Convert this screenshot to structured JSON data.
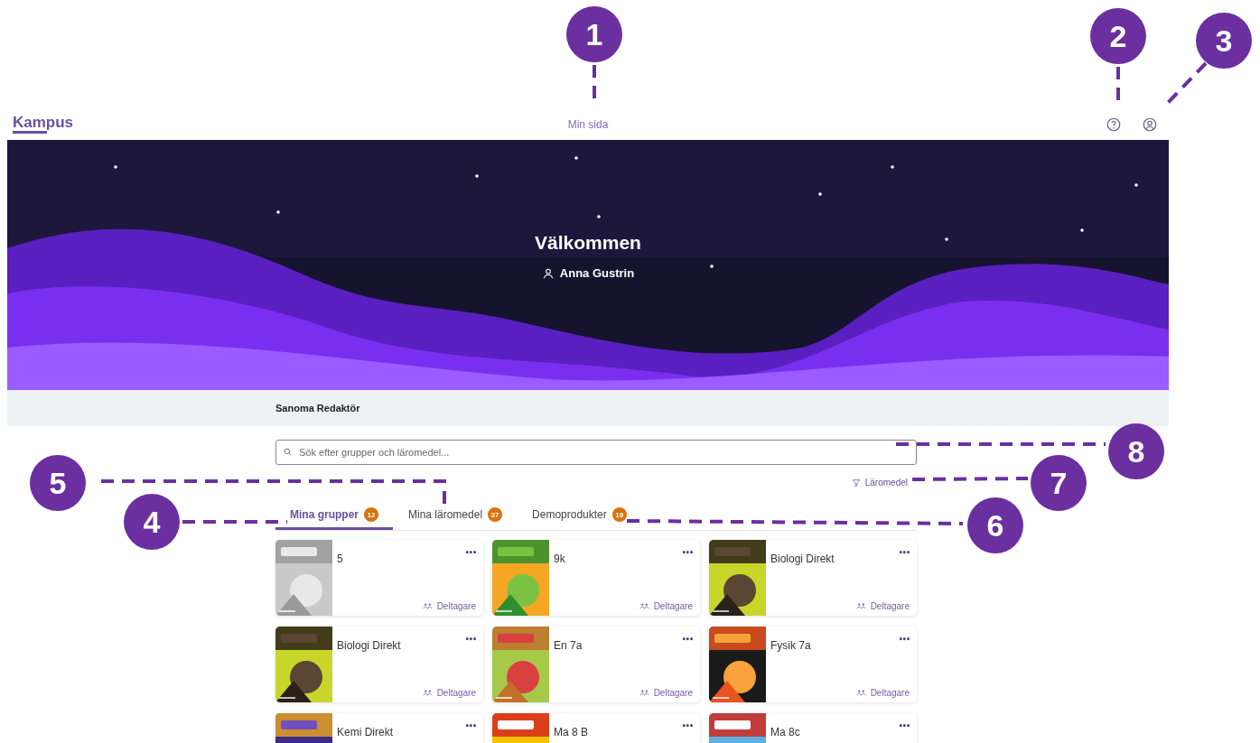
{
  "header": {
    "logo": "Kampus",
    "nav_link": "Min sida"
  },
  "banner": {
    "title": "Välkommen",
    "user": "Anna Gustrin"
  },
  "organization": "Sanoma Redaktör",
  "search": {
    "placeholder": "Sök efter grupper och läromedel..."
  },
  "filter": {
    "label": "Läromedel"
  },
  "tabs": [
    {
      "label": "Mina grupper",
      "count": "12",
      "selected": true
    },
    {
      "label": "Mina läromedel",
      "count": "37",
      "selected": false
    },
    {
      "label": "Demoprodukter",
      "count": "19",
      "selected": false
    }
  ],
  "cards": [
    {
      "title": "5",
      "menu": "•••",
      "participants": "Deltagare"
    },
    {
      "title": "9k",
      "menu": "•••",
      "participants": "Deltagare"
    },
    {
      "title": "Biologi Direkt",
      "menu": "•••",
      "participants": "Deltagare"
    },
    {
      "title": "Biologi Direkt",
      "menu": "•••",
      "participants": "Deltagare"
    },
    {
      "title": "En 7a",
      "menu": "•••",
      "participants": "Deltagare"
    },
    {
      "title": "Fysik 7a",
      "menu": "•••",
      "participants": "Deltagare"
    },
    {
      "title": "Kemi Direkt",
      "menu": "•••"
    },
    {
      "title": "Ma 8 B",
      "menu": "•••"
    },
    {
      "title": "Ma 8c",
      "menu": "•••"
    }
  ],
  "callouts": [
    {
      "label": "1"
    },
    {
      "label": "2"
    },
    {
      "label": "3"
    },
    {
      "label": "4"
    },
    {
      "label": "5"
    },
    {
      "label": "6"
    },
    {
      "label": "7"
    },
    {
      "label": "8"
    }
  ]
}
